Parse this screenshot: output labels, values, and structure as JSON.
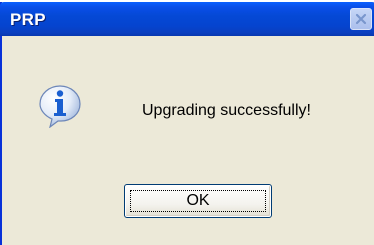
{
  "window": {
    "title": "PRP"
  },
  "dialog": {
    "message": "Upgrading successfully!",
    "icon": "info-icon",
    "ok_label": "OK"
  },
  "colors": {
    "titlebar_blue": "#0549d6",
    "dialog_face": "#ece9d8",
    "icon_blue": "#1a5fd0"
  }
}
